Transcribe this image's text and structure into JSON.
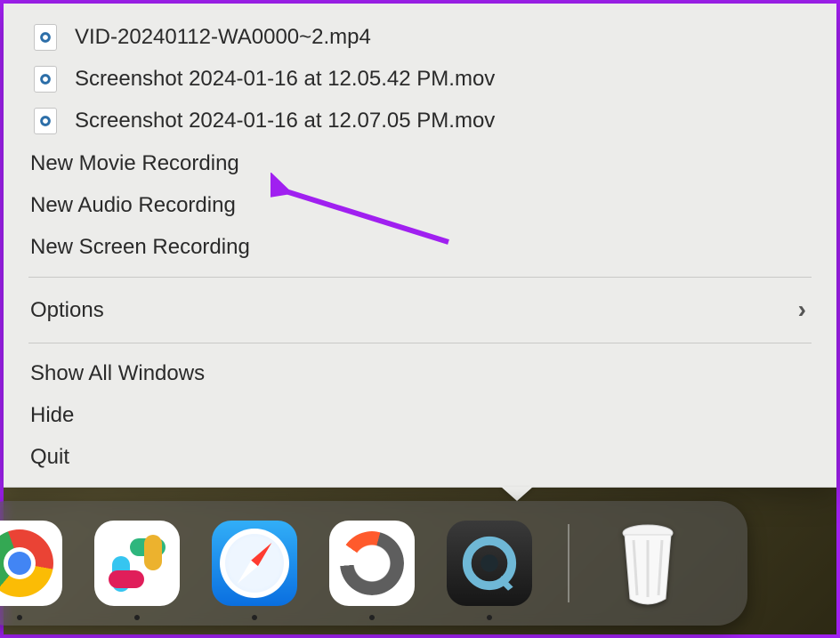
{
  "menu": {
    "recent_files": [
      "VID-20240112-WA0000~2.mp4",
      "Screenshot 2024-01-16 at 12.05.42 PM.mov",
      "Screenshot 2024-01-16 at 12.07.05 PM.mov"
    ],
    "new_movie": "New Movie Recording",
    "new_audio": "New Audio Recording",
    "new_screen": "New Screen Recording",
    "options": "Options",
    "show_all": "Show All Windows",
    "hide": "Hide",
    "quit": "Quit"
  },
  "dock": {
    "apps": [
      {
        "name": "chrome",
        "running": true
      },
      {
        "name": "slack",
        "running": true
      },
      {
        "name": "safari",
        "running": true
      },
      {
        "name": "loader",
        "running": true
      },
      {
        "name": "quicktime",
        "running": true
      }
    ],
    "trash": "Trash"
  },
  "annotation": {
    "target": "New Audio Recording",
    "color": "#a020f0"
  }
}
